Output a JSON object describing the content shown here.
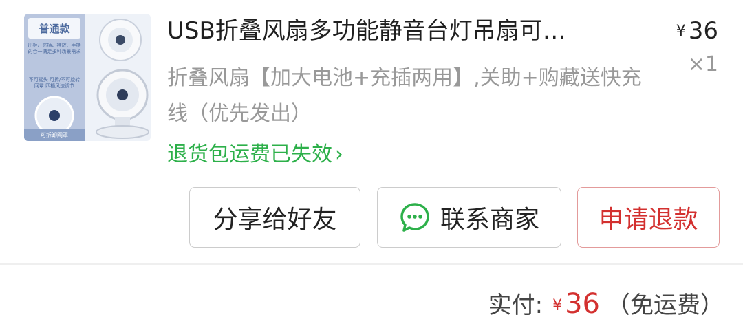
{
  "product": {
    "title": "USB折叠风扇多功能静音台灯吊扇可…",
    "price_currency": "¥",
    "price": "36",
    "quantity": "×1",
    "spec": "折叠风扇【加大电池+充插两用】,关助+购藏送快充线（优先发出）",
    "return_link": "退货包运费已失效",
    "chevron": "›"
  },
  "thumbnail": {
    "badge": "普通款",
    "fine_print_1": "出柜、充插、挂放、手持 的合一满足多种场景需求",
    "fine_print_2": "不可摇头 可拆/不可旋转网罩 四档风速调节",
    "bottom_label": "可拆卸网罩"
  },
  "actions": {
    "share_label": "分享给好友",
    "contact_label": "联系商家",
    "refund_label": "申请退款"
  },
  "payment": {
    "label": "实付:",
    "currency": "¥",
    "amount": "36",
    "note": "（免运费）"
  },
  "colors": {
    "accent_green": "#2db04a",
    "accent_red": "#d3302f",
    "chat_icon": "#2db04a"
  }
}
